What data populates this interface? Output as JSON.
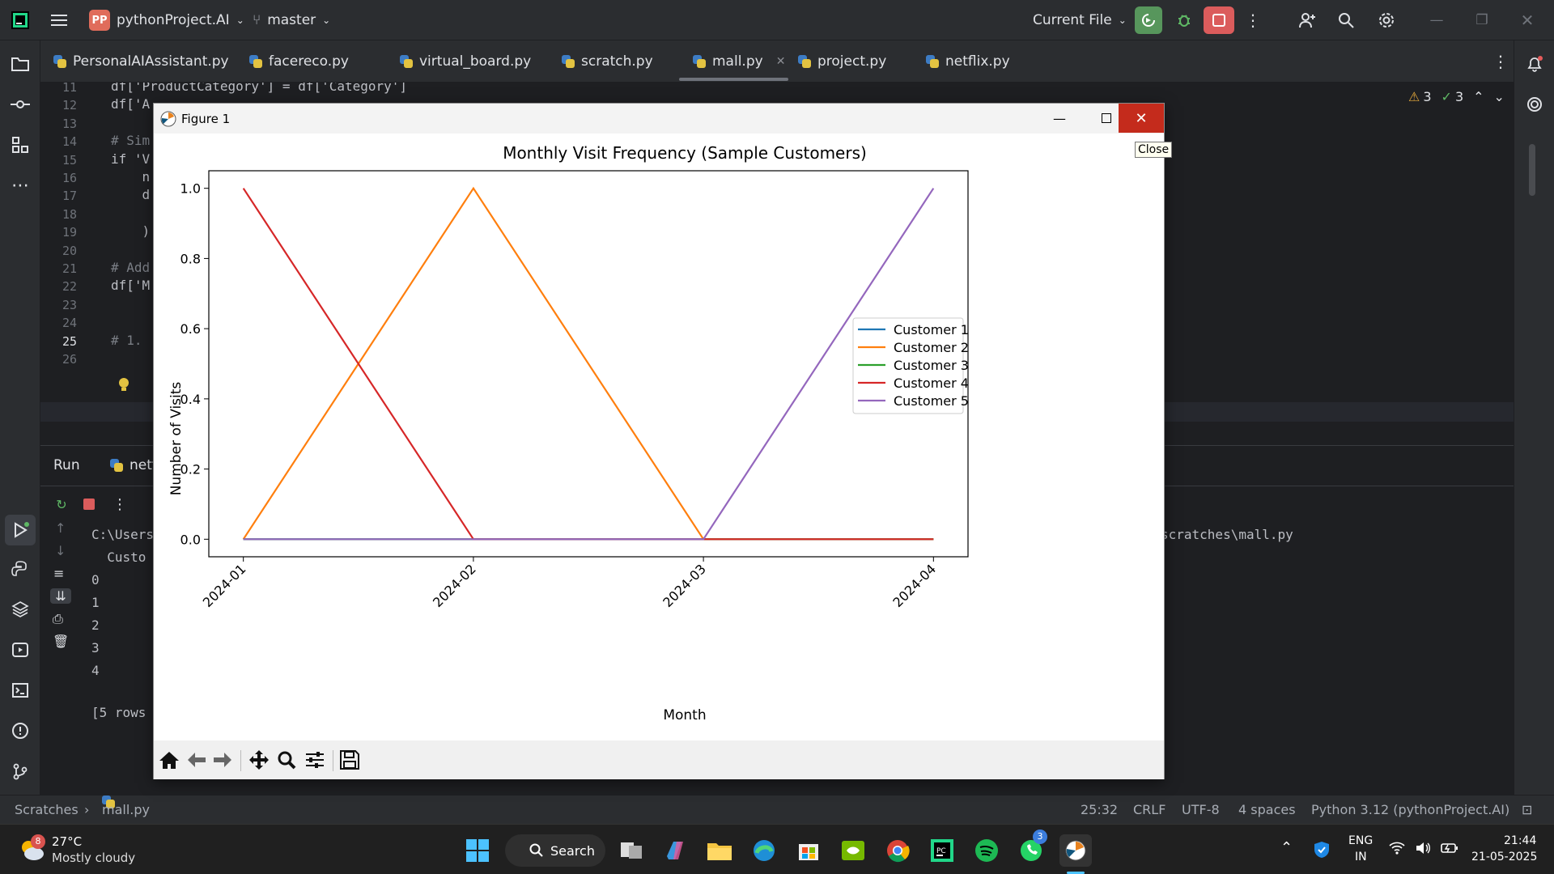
{
  "ide": {
    "project_initials": "PP",
    "project_name": "pythonProject.AI",
    "branch": "master",
    "run_config": "Current File"
  },
  "tabs": [
    {
      "label": "PersonalAIAssistant.py"
    },
    {
      "label": "facereco.py"
    },
    {
      "label": "virtual_board.py"
    },
    {
      "label": "scratch.py"
    },
    {
      "label": "mall.py",
      "active": true
    },
    {
      "label": "project.py"
    },
    {
      "label": "netflix.py"
    }
  ],
  "inspections": {
    "warnings": "3",
    "typos": "3"
  },
  "editor": {
    "line_numbers": [
      "11",
      "12",
      "13",
      "14",
      "15",
      "16",
      "17",
      "18",
      "19",
      "20",
      "21",
      "22",
      "23",
      "24",
      "25",
      "26"
    ],
    "lines": [
      "df['ProductCategory'] = df['Category']",
      "df['A",
      "",
      "# Sim",
      "if 'V",
      "    n",
      "    d",
      "",
      "    )",
      "",
      "# Add",
      "df['M",
      "",
      "",
      "# 1.",
      ""
    ]
  },
  "run": {
    "tab_label": "Run",
    "config_label": "netf",
    "path_left": "C:\\Users",
    "path_right": "scratches\\mall.py",
    "header": "  Custo",
    "rows": [
      "0",
      "1",
      "2",
      "3",
      "4"
    ],
    "footer": "[5 rows"
  },
  "status": {
    "breadcrumb_root": "Scratches",
    "breadcrumb_file": "mall.py",
    "position": "25:32",
    "line_sep": "CRLF",
    "encoding": "UTF-8",
    "indent": "4 spaces",
    "interpreter": "Python 3.12 (pythonProject.AI)"
  },
  "figure": {
    "window_title": "Figure 1",
    "close_tooltip": "Close"
  },
  "chart_data": {
    "type": "line",
    "title": "Monthly Visit Frequency (Sample Customers)",
    "xlabel": "Month",
    "ylabel": "Number of Visits",
    "categories": [
      "2024-01",
      "2024-02",
      "2024-03",
      "2024-04"
    ],
    "ylim": [
      -0.05,
      1.05
    ],
    "yticks": [
      "0.0",
      "0.2",
      "0.4",
      "0.6",
      "0.8",
      "1.0"
    ],
    "ytick_values": [
      0,
      0.2,
      0.4,
      0.6,
      0.8,
      1.0
    ],
    "grid": false,
    "legend_position": "center-right",
    "series": [
      {
        "name": "Customer 1",
        "color": "#1f77b4",
        "values": [
          0,
          0,
          0,
          0
        ]
      },
      {
        "name": "Customer 2",
        "color": "#ff7f0e",
        "values": [
          0,
          1,
          0,
          0
        ]
      },
      {
        "name": "Customer 3",
        "color": "#2ca02c",
        "values": [
          0,
          0,
          0,
          0
        ]
      },
      {
        "name": "Customer 4",
        "color": "#d62728",
        "values": [
          1,
          0,
          0,
          0
        ]
      },
      {
        "name": "Customer 5",
        "color": "#9467bd",
        "values": [
          0,
          0,
          0,
          1
        ]
      }
    ]
  },
  "taskbar": {
    "weather_temp": "27°C",
    "weather_desc": "Mostly cloudy",
    "weather_badge": "8",
    "search_label": "Search",
    "whatsapp_badge": "3",
    "lang": "ENG",
    "region": "IN",
    "time": "21:44",
    "date": "21-05-2025"
  }
}
